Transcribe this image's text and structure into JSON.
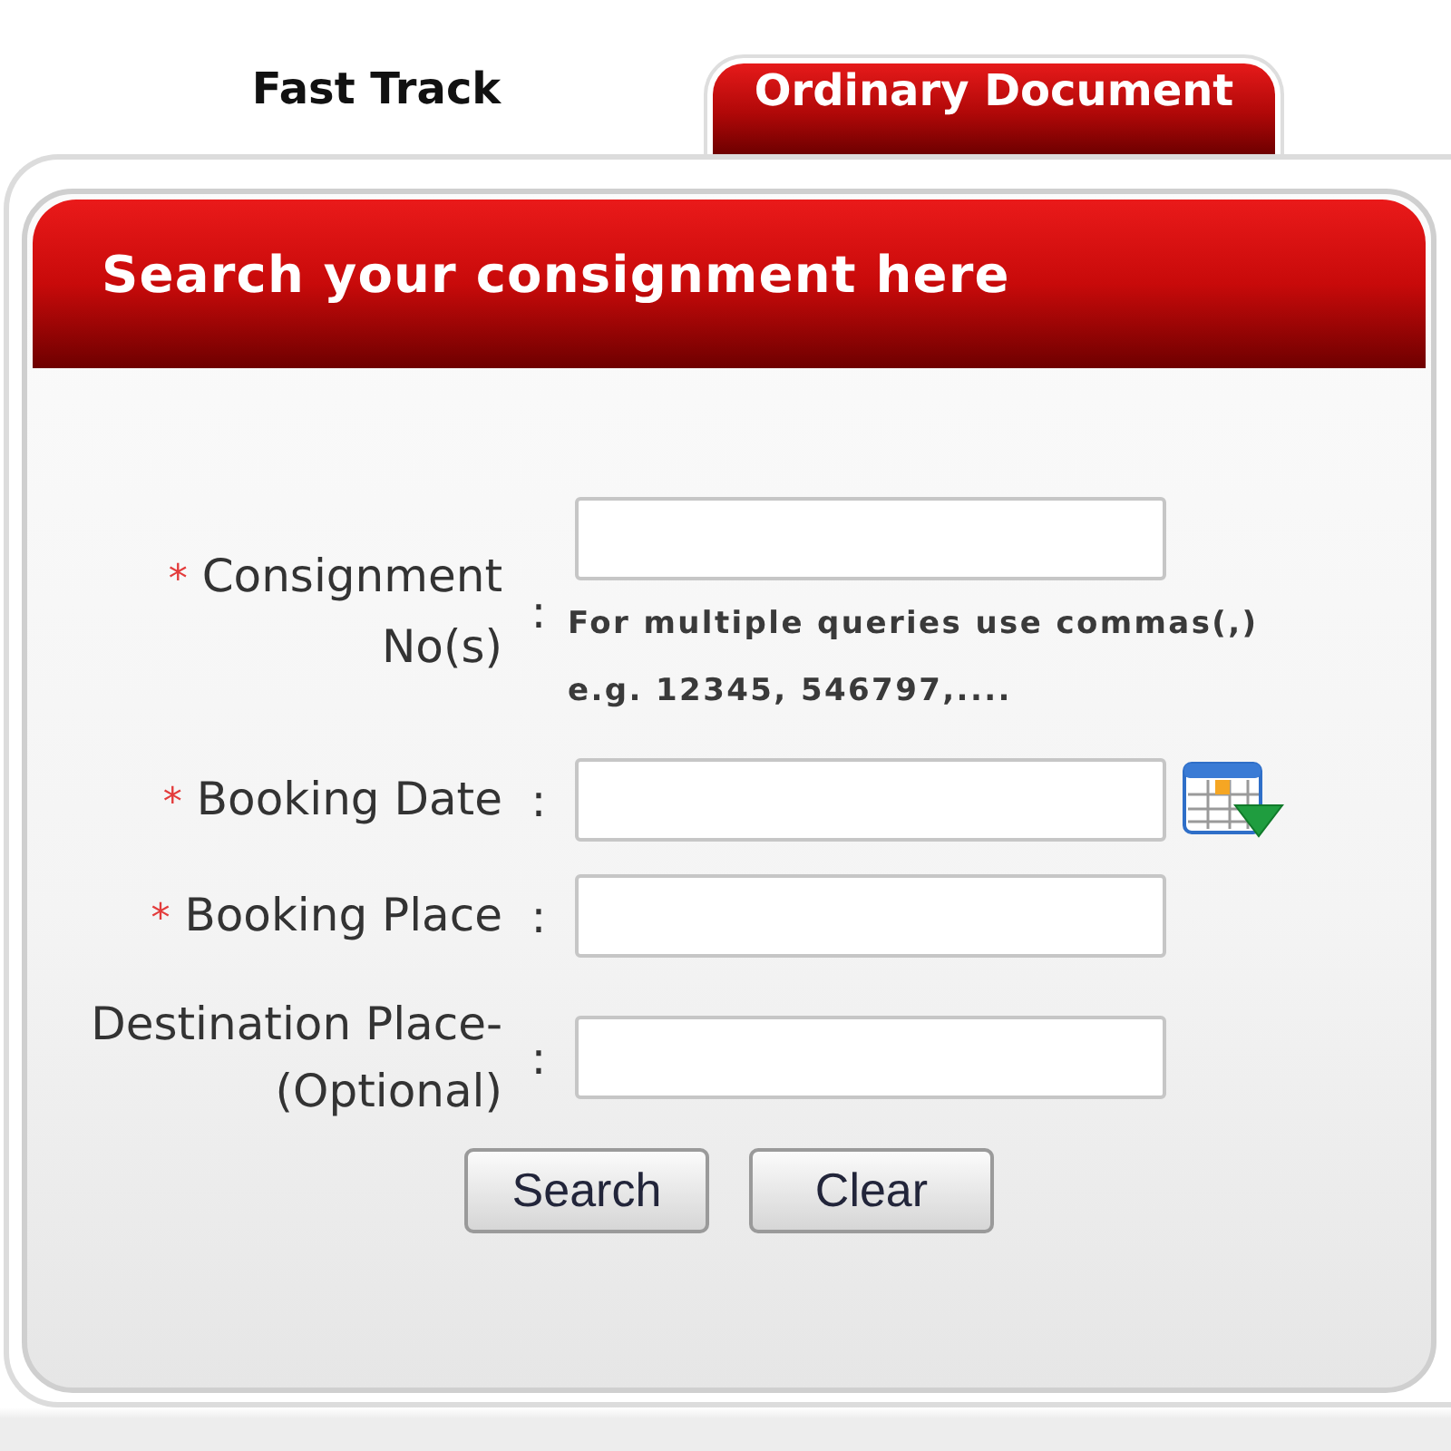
{
  "tabs": [
    {
      "label": "Fast Track",
      "selected": false
    },
    {
      "label": "Ordinary Document",
      "selected": true
    }
  ],
  "panel": {
    "title": "Search your consignment here"
  },
  "fields": [
    {
      "kind": "text",
      "required_mark": "*",
      "label": "Consignment No(s)",
      "separator": ":",
      "hint": [
        "For multiple queries use commas(,)",
        "e.g. 12345, 546797,...."
      ]
    },
    {
      "kind": "date",
      "required_mark": "*",
      "label": "Booking Date",
      "separator": ":"
    },
    {
      "kind": "text",
      "required_mark": "*",
      "label": "Booking Place",
      "separator": ":"
    },
    {
      "kind": "text",
      "label": "Destination Place-(Optional)",
      "separator": ":"
    }
  ],
  "buttons": [
    {
      "label": "Search"
    },
    {
      "label": "Clear"
    }
  ]
}
